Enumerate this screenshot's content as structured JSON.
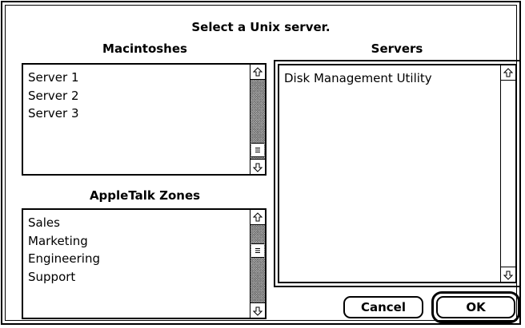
{
  "dialog": {
    "title": "Select a Unix server."
  },
  "macintoshes": {
    "label": "Macintoshes",
    "items": [
      "Server 1",
      "Server 2",
      "Server 3"
    ]
  },
  "zones": {
    "label": "AppleTalk Zones",
    "items": [
      "Sales",
      "Marketing",
      "Engineering",
      "Support"
    ]
  },
  "servers": {
    "label": "Servers",
    "items": [
      "Disk Management Utility"
    ]
  },
  "buttons": {
    "cancel": "Cancel",
    "ok": "OK"
  },
  "icons": {
    "scroll_up": "up-arrow-icon",
    "scroll_down": "down-arrow-icon",
    "thumb": "scroll-thumb-grip-icon"
  }
}
